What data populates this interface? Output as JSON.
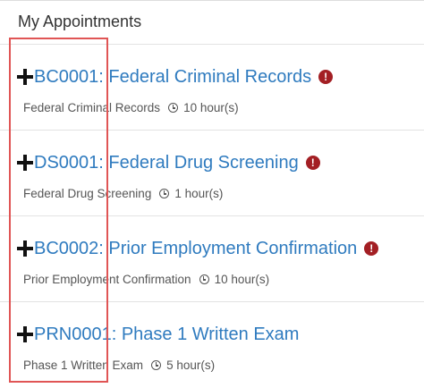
{
  "panel": {
    "title": "My Appointments"
  },
  "appointments": [
    {
      "title": "BC0001: Federal Criminal Records",
      "description": "Federal Criminal Records",
      "duration": "10 hour(s)",
      "has_alert": true
    },
    {
      "title": "DS0001: Federal Drug Screening",
      "description": "Federal Drug Screening",
      "duration": "1 hour(s)",
      "has_alert": true
    },
    {
      "title": "BC0002: Prior Employment Confirmation",
      "description": "Prior Employment Confirmation",
      "duration": "10 hour(s)",
      "has_alert": true
    },
    {
      "title": "PRN0001: Phase 1 Written Exam",
      "description": "Phase 1 Written Exam",
      "duration": "5 hour(s)",
      "has_alert": false
    }
  ],
  "icons": {
    "expand": "plus-icon",
    "alert": "exclamation-circle-icon",
    "duration": "clock-icon",
    "alert_glyph": "!"
  },
  "colors": {
    "link": "#2f7bbf",
    "alert": "#a31f24",
    "highlight_box": "#e05555"
  }
}
